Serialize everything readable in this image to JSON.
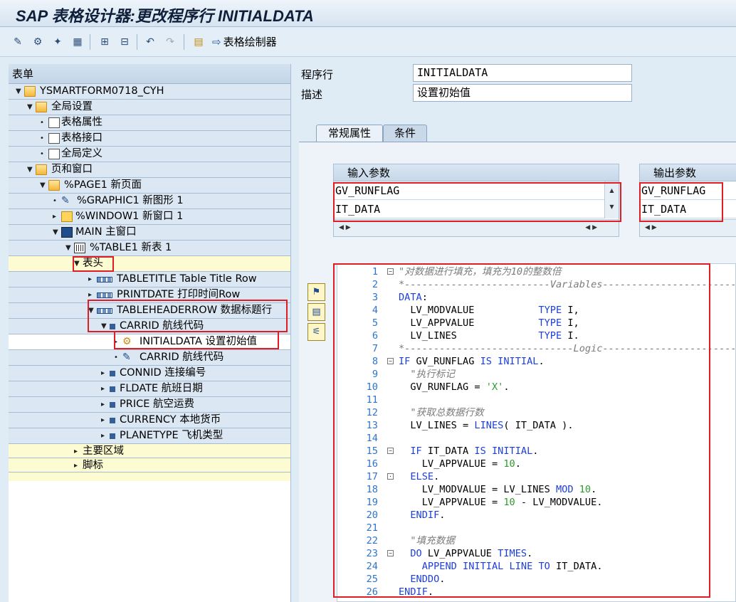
{
  "window": {
    "title": "SAP 表格设计器:更改程序行 INITIALDATA"
  },
  "toolbar": {
    "form_painter_label": "表格绘制器"
  },
  "tree": {
    "header": "表单",
    "rows": [
      {
        "label": "YSMARTFORM0718_CYH"
      },
      {
        "label": "全局设置"
      },
      {
        "label": "表格属性"
      },
      {
        "label": "表格接口"
      },
      {
        "label": "全局定义"
      },
      {
        "label": "页和窗口"
      },
      {
        "label": "%PAGE1 新页面"
      },
      {
        "label": "%GRAPHIC1 新图形 1"
      },
      {
        "label": "%WINDOW1 新窗口 1"
      },
      {
        "label": "MAIN 主窗口"
      },
      {
        "label": "%TABLE1 新表 1"
      },
      {
        "label": "表头"
      },
      {
        "label": "TABLETITLE Table Title Row"
      },
      {
        "label": "PRINTDATE 打印时间Row"
      },
      {
        "label": "TABLEHEADERROW 数据标题行"
      },
      {
        "label": "CARRID 航线代码"
      },
      {
        "label": "INITIALDATA 设置初始值"
      },
      {
        "label": "CARRID 航线代码"
      },
      {
        "label": "CONNID 连接编号"
      },
      {
        "label": "FLDATE 航班日期"
      },
      {
        "label": "PRICE 航空运费"
      },
      {
        "label": "CURRENCY 本地货币"
      },
      {
        "label": "PLANETYPE 飞机类型"
      },
      {
        "label": "主要区域"
      },
      {
        "label": "脚标"
      }
    ]
  },
  "form": {
    "program_line_label": "程序行",
    "program_line_value": "INITIALDATA",
    "description_label": "描述",
    "description_value": "设置初始值"
  },
  "tabs": {
    "general": "常规属性",
    "conditions": "条件"
  },
  "params": {
    "input_header": "输入参数",
    "input": [
      "GV_RUNFLAG",
      "IT_DATA"
    ],
    "output_header": "输出参数",
    "output": [
      "GV_RUNFLAG",
      "IT_DATA"
    ]
  },
  "code": {
    "lines": [
      "\"对数据进行填充，填充为10的整数倍",
      "*-------------------------Variables-----------------------",
      "DATA:",
      "  LV_MODVALUE           TYPE I,",
      "  LV_APPVALUE           TYPE I,",
      "  LV_LINES              TYPE I.",
      "*-----------------------------Logic-----------------------",
      "IF GV_RUNFLAG IS INITIAL.",
      "  \"执行标记",
      "  GV_RUNFLAG = 'X'.",
      "",
      "  \"获取总数据行数",
      "  LV_LINES = LINES( IT_DATA ).",
      "",
      "  IF IT_DATA IS INITIAL.",
      "    LV_APPVALUE = 10.",
      "  ELSE.",
      "    LV_MODVALUE = LV_LINES MOD 10.",
      "    LV_APPVALUE = 10 - LV_MODVALUE.",
      "  ENDIF.",
      "",
      "  \"填充数据",
      "  DO LV_APPVALUE TIMES.",
      "    APPEND INITIAL LINE TO IT_DATA.",
      "  ENDDO.",
      "ENDIF."
    ]
  }
}
